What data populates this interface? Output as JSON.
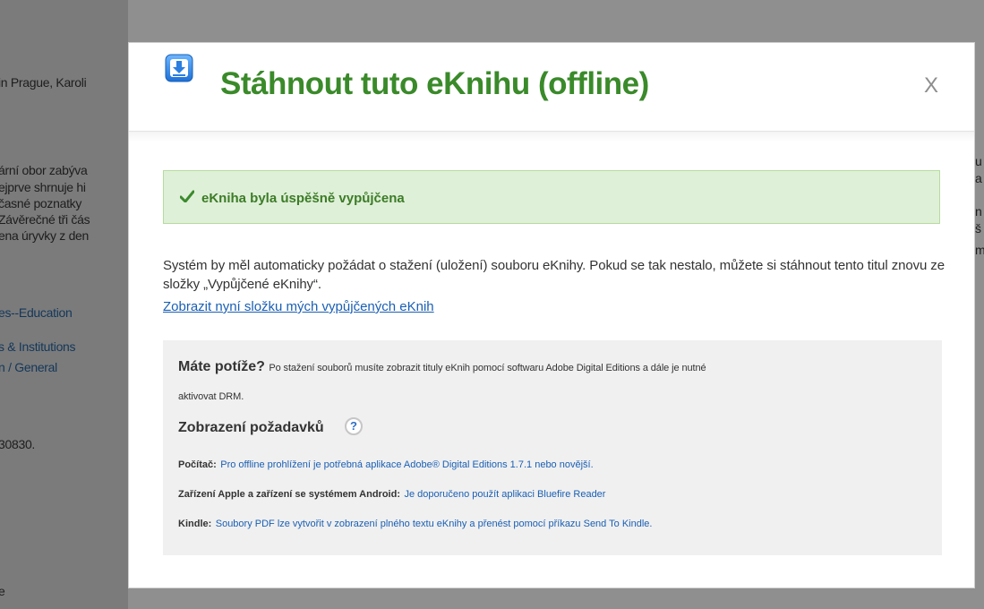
{
  "background": {
    "left_fragments": [
      "in Prague, Karoli",
      "ární obor zabýva",
      "ejprve shrnuje hi",
      "časné poznatky",
      "Závěrečné tři čás",
      "ena úryvky z den",
      "es--Education",
      "s & Institutions",
      "n / General",
      "30830.",
      "e"
    ],
    "right_fragments": [
      "u",
      "a",
      "n",
      "š",
      "m"
    ]
  },
  "modal": {
    "title": "Stáhnout tuto eKnihu (offline)",
    "close_label": "X",
    "success_message": "eKniha byla úspěšně vypůjčena",
    "info_text": "Systém by měl automaticky požádat o stažení (uložení) souboru eKnihy. Pokud se tak nestalo, můžete si stáhnout tento titul znovu ze složky „Vypůjčené eKnihy“.",
    "folder_link": "Zobrazit nyní složku mých vypůjčených eKnih",
    "help": {
      "trouble_heading": "Máte potíže?",
      "trouble_text_1": "Po stažení souborů musíte zobrazit tituly eKnih pomocí softwaru Adobe Digital Editions a dále je nutné",
      "trouble_text_2": "aktivovat DRM.",
      "requirements_heading": "Zobrazení požadavků",
      "help_icon_label": "?",
      "requirements": [
        {
          "label": "Počítač:",
          "value": "Pro offline prohlížení je potřebná aplikace Adobe® Digital Editions 1.7.1 nebo novější."
        },
        {
          "label": "Zařízení Apple a zařízení se systémem Android:",
          "value": "Je doporučeno použít aplikaci Bluefire Reader"
        },
        {
          "label": "Kindle:",
          "value": "Soubory PDF lze vytvořit v zobrazení plného textu eKnihy a přenést pomocí příkazu Send To Kindle."
        }
      ]
    }
  },
  "colors": {
    "title_green": "#3a8a2a",
    "success_bg": "#dff0d8",
    "link_blue": "#1a5fb4",
    "overlay_gray": "#8f8f8f"
  }
}
